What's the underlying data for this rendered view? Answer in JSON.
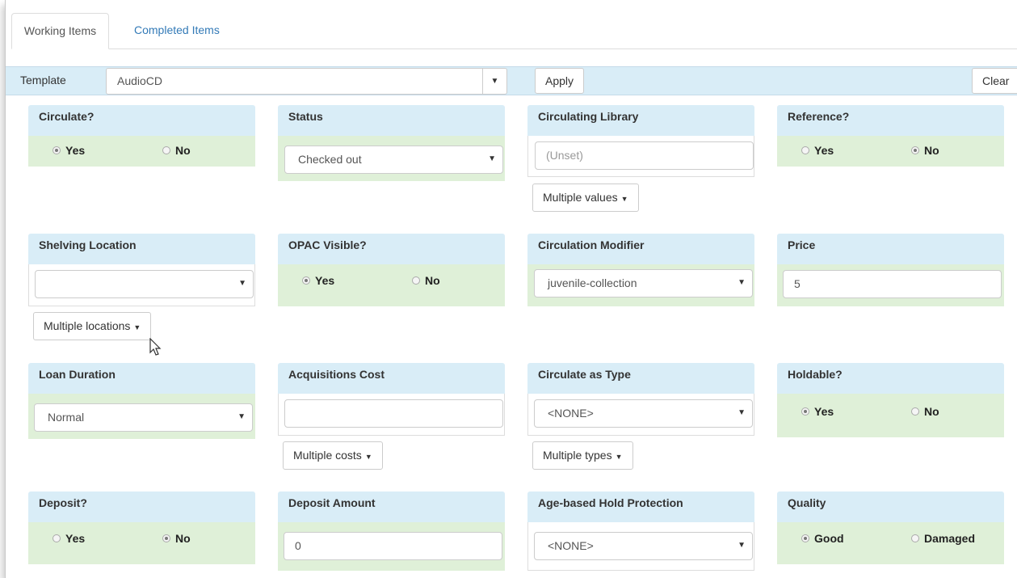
{
  "tabs": [
    {
      "label": "Working Items"
    },
    {
      "label": "Completed Items"
    }
  ],
  "template": {
    "label": "Template",
    "value": "AudioCD",
    "apply_label": "Apply",
    "clear_label": "Clear"
  },
  "fields": {
    "circulate": {
      "label": "Circulate?",
      "yes": "Yes",
      "no": "No",
      "selected": "Yes"
    },
    "status": {
      "label": "Status",
      "value": "Checked out"
    },
    "circ_library": {
      "label": "Circulating Library",
      "placeholder": "(Unset)",
      "multi_label": "Multiple values"
    },
    "reference": {
      "label": "Reference?",
      "yes": "Yes",
      "no": "No",
      "selected": "No"
    },
    "shelving_location": {
      "label": "Shelving Location",
      "value": "",
      "multi_label": "Multiple locations"
    },
    "opac_visible": {
      "label": "OPAC Visible?",
      "yes": "Yes",
      "no": "No",
      "selected": "Yes"
    },
    "circ_modifier": {
      "label": "Circulation Modifier",
      "value": "juvenile-collection"
    },
    "price": {
      "label": "Price",
      "value": "5"
    },
    "loan_duration": {
      "label": "Loan Duration",
      "value": "Normal"
    },
    "acq_cost": {
      "label": "Acquisitions Cost",
      "value": "",
      "multi_label": "Multiple costs"
    },
    "circ_as_type": {
      "label": "Circulate as Type",
      "value": "<NONE>",
      "multi_label": "Multiple types"
    },
    "holdable": {
      "label": "Holdable?",
      "yes": "Yes",
      "no": "No",
      "selected": "Yes"
    },
    "deposit": {
      "label": "Deposit?",
      "yes": "Yes",
      "no": "No",
      "selected": "No"
    },
    "deposit_amount": {
      "label": "Deposit Amount",
      "value": "0"
    },
    "age_hold": {
      "label": "Age-based Hold Protection",
      "value": "<NONE>"
    },
    "quality": {
      "label": "Quality",
      "yes": "Good",
      "no": "Damaged",
      "selected": "Good"
    }
  },
  "colors": {
    "field_header": "#d9edf7",
    "radio_body": "#dff0d8",
    "link": "#337ab7"
  }
}
